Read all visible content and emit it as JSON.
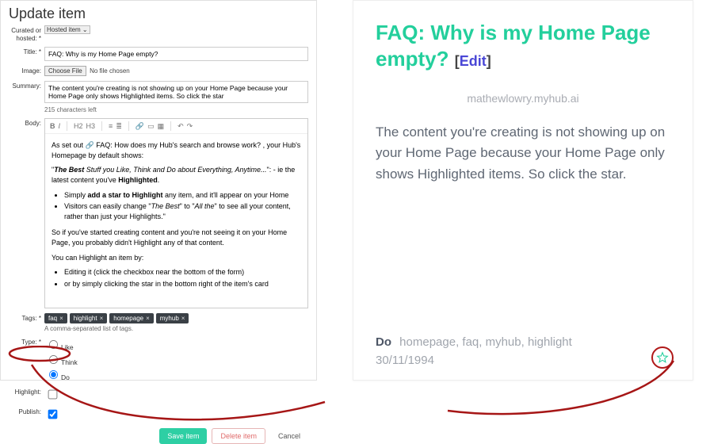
{
  "form": {
    "heading": "Update item",
    "curated_label": "Curated or hosted: *",
    "curated_value": "Hosted item",
    "title_label": "Title: *",
    "title_value": "FAQ: Why is my Home Page empty?",
    "image_label": "Image:",
    "choose_file": "Choose File",
    "no_file": "No file chosen",
    "summary_label": "Summary:",
    "summary_value": "The content you're creating is not showing up on your Home Page because your Home Page only shows Highlighted items. So click the star",
    "char_hint": "215 characters left",
    "body_label": "Body:",
    "body": {
      "p1_prefix": "As set out ",
      "p1_link": "🔗 FAQ: How does my Hub's search and browse work?",
      "p1_suffix": ", your Hub's Homepage by default shows:",
      "p2_open": "\"",
      "p2_bold1": "The Best",
      "p2_mid1": " Stuff you Like, Think and Do about ",
      "p2_italic": "Everything, Anytime...",
      "p2_mid2": "\": - ie the latest content you've ",
      "p2_bold2": "Highlighted",
      "p2_end": ".",
      "li1_a": "Simply ",
      "li1_bold": "add a star to Highlight",
      "li1_b": " any item, and it'll appear on your Home",
      "li2_a": "Visitors can easily change \"",
      "li2_i1": "The Best",
      "li2_b": "\" to \"",
      "li2_i2": "All the",
      "li2_c": "\" to see all your content, rather than just your Highlights.\"",
      "p3": "So if you've started creating content and you're not seeing it on your Home Page, you probably didn't Highlight any of that content.",
      "p4": "You can Highlight an item by:",
      "li3": "Editing it (click the checkbox near the bottom of the form)",
      "li4": "or by simply clicking the star in the bottom right of the item's card"
    },
    "tags_label": "Tags: *",
    "tags": [
      "faq",
      "highlight",
      "homepage",
      "myhub"
    ],
    "tags_hint": "A comma-separated list of tags.",
    "type_label": "Type: *",
    "type_options": {
      "like": "Like",
      "think": "Think",
      "do": "Do"
    },
    "type_selected": "do",
    "highlight_label": "Highlight:",
    "highlight_checked": false,
    "publish_label": "Publish:",
    "publish_checked": true,
    "save": "Save item",
    "delete": "Delete item",
    "cancel": "Cancel"
  },
  "preview": {
    "title": "FAQ: Why is my Home Page empty?",
    "edit": "Edit",
    "domain": "mathewlowry.myhub.ai",
    "desc": "The content you're creating is not showing up on your Home Page because your Home Page only shows Highlighted items. So click the star.",
    "do": "Do",
    "tags_inline": "homepage, faq, myhub, highlight",
    "date": "30/11/1994"
  }
}
